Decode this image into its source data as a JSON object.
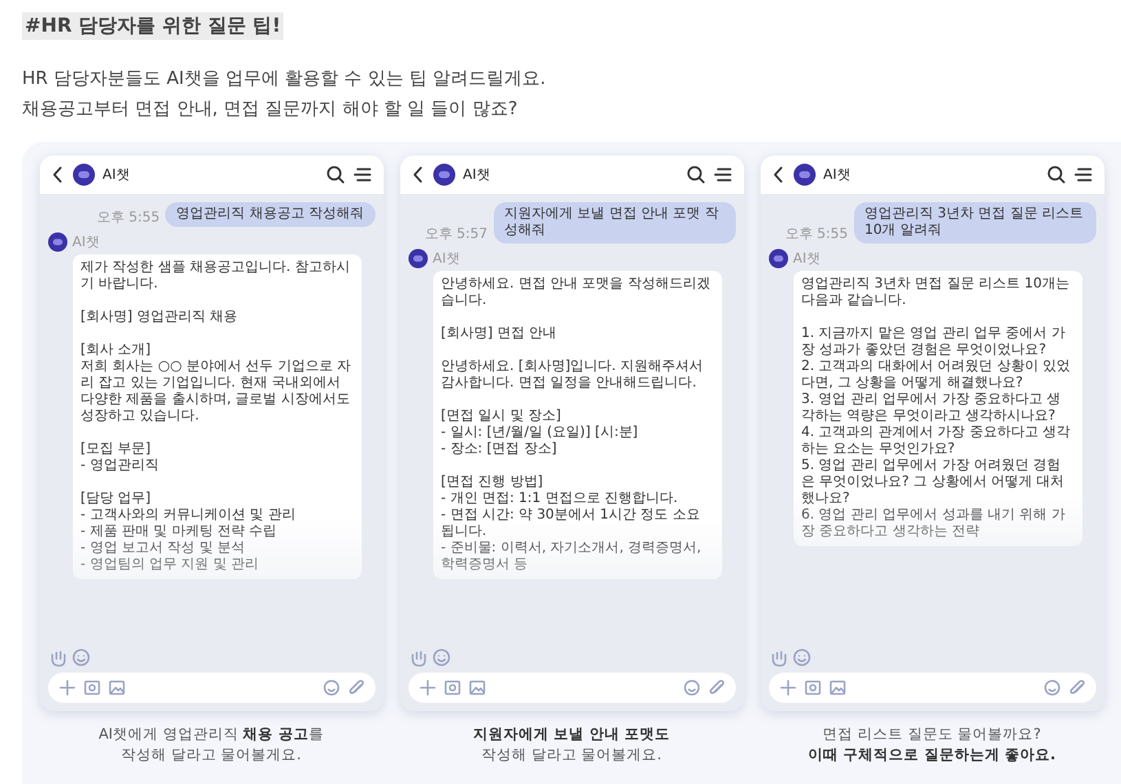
{
  "heading": "#HR 담당자를 위한 질문 팁!",
  "intro": "HR 담당자분들도 AI챗을 업무에 활용할 수 있는 팁 알려드릴게요.\n채용공고부터 면접 안내, 면접 질문까지 해야 할 일 들이 많죠?",
  "phones": [
    {
      "header_title": "AI챗",
      "user_message": "영업관리직 채용공고 작성해줘",
      "time": "오후 5:55",
      "bot_name": "AI챗",
      "bot_message": "제가 작성한 샘플 채용공고입니다. 참고하시기 바랍니다.\n\n[회사명] 영업관리직 채용\n\n[회사 소개]\n저희 회사는 ○○ 분야에서 선두 기업으로 자리 잡고 있는 기업입니다. 현재 국내외에서 다양한 제품을 출시하며, 글로벌 시장에서도 성장하고 있습니다.\n\n[모집 부문]\n- 영업관리직\n\n[담당 업무]\n- 고객사와의 커뮤니케이션 및 관리\n- 제품 판매 및 마케팅 전략 수립\n- 영업 보고서 작성 및 분석\n- 영업팀의 업무 지원 및 관리",
      "caption": "AI챗에게 영업관리직 **채용 공고**를\n작성해 달라고 물어볼게요."
    },
    {
      "header_title": "AI챗",
      "user_message": "지원자에게 보낼 면접 안내 포맷 작성해줘",
      "time": "오후 5:57",
      "bot_name": "AI챗",
      "bot_message": "안녕하세요. 면접 안내 포맷을 작성해드리겠습니다.\n\n[회사명] 면접 안내\n\n안녕하세요. [회사명]입니다. 지원해주셔서 감사합니다. 면접 일정을 안내해드립니다.\n\n[면접 일시 및 장소]\n- 일시: [년/월/일 (요일)] [시:분]\n- 장소: [면접 장소]\n\n[면접 진행 방법]\n- 개인 면접: 1:1 면접으로 진행합니다.\n- 면접 시간: 약 30분에서 1시간 정도 소요됩니다.\n- 준비물: 이력서, 자기소개서, 경력증명서, 학력증명서 등",
      "caption": "**지원자에게 보낼 안내 포맷도**\n작성해 달라고 물어볼게요."
    },
    {
      "header_title": "AI챗",
      "user_message": "영업관리직 3년차 면접 질문 리스트 10개 알려줘",
      "time": "오후 5:55",
      "bot_name": "AI챗",
      "bot_message": "영업관리직 3년차 면접 질문 리스트 10개는 다음과 같습니다.\n\n1. 지금까지 맡은 영업 관리 업무 중에서 가장 성과가 좋았던 경험은 무엇이었나요?\n2. 고객과의 대화에서 어려웠던 상황이 있었다면, 그 상황을 어떻게 해결했나요?\n3. 영업 관리 업무에서 가장 중요하다고 생각하는 역량은 무엇이라고 생각하시나요?\n4. 고객과의 관계에서 가장 중요하다고 생각하는 요소는 무엇인가요?\n5. 영업 관리 업무에서 가장 어려웠던 경험은 무엇이었나요? 그 상황에서 어떻게 대처했나요?\n6. 영업 관리 업무에서 성과를 내기 위해 가장 중요하다고 생각하는 전략",
      "caption": "면접 리스트 질문도 물어볼까요?\n**이때 구체적으로 질문하는게 좋아요.**"
    }
  ]
}
